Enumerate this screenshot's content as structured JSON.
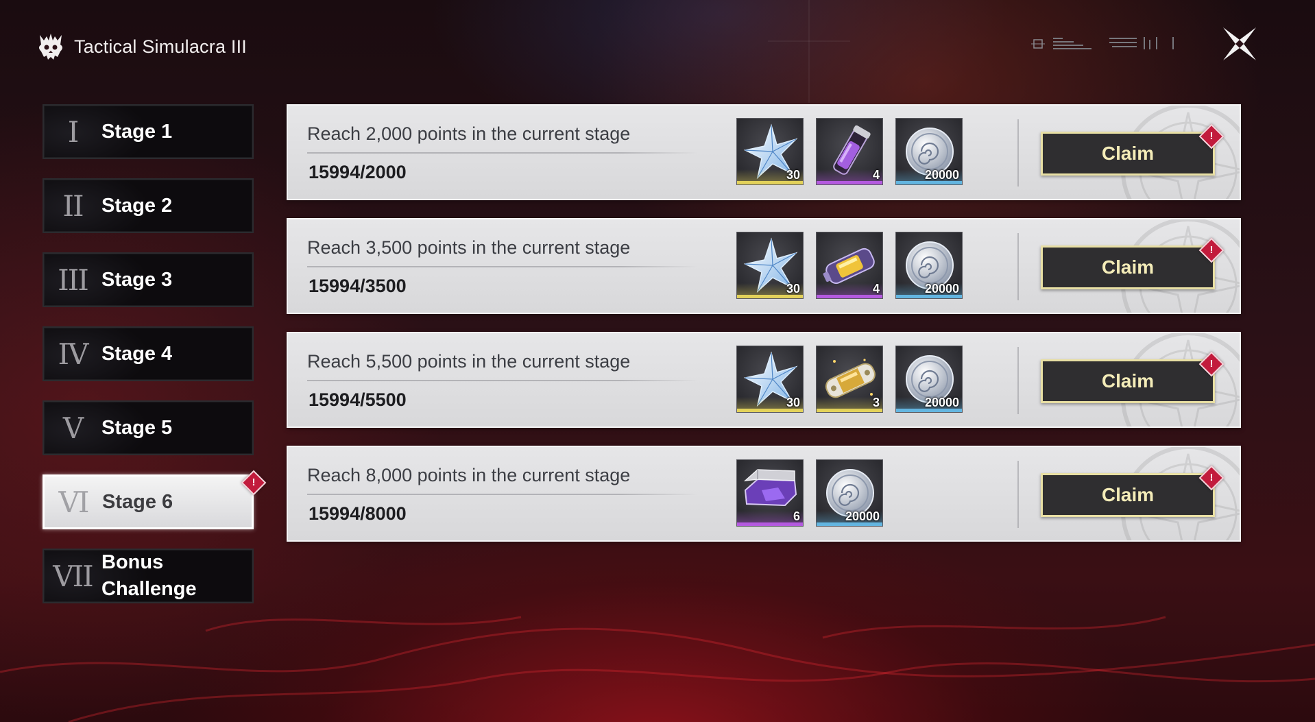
{
  "header": {
    "title": "Tactical Simulacra III",
    "logo_icon": "demon-skull-icon",
    "close_icon": "close-x-icon"
  },
  "colors": {
    "accent_gold": "#e8dfa4",
    "badge_red": "#c21b3c",
    "rarity_gold": "#e2d15a",
    "rarity_purple": "#b45adf",
    "rarity_blue": "#63b5e0"
  },
  "sidebar": {
    "items": [
      {
        "numeral": "I",
        "label": "Stage 1",
        "active": false,
        "badge": false
      },
      {
        "numeral": "II",
        "label": "Stage 2",
        "active": false,
        "badge": false
      },
      {
        "numeral": "III",
        "label": "Stage 3",
        "active": false,
        "badge": false
      },
      {
        "numeral": "IV",
        "label": "Stage 4",
        "active": false,
        "badge": false
      },
      {
        "numeral": "V",
        "label": "Stage 5",
        "active": false,
        "badge": false
      },
      {
        "numeral": "VI",
        "label": "Stage 6",
        "active": true,
        "badge": true
      },
      {
        "numeral": "VII",
        "label": "Bonus Challenge",
        "active": false,
        "badge": false
      }
    ]
  },
  "missions": [
    {
      "description": "Reach 2,000 points in the current stage",
      "progress": "15994/2000",
      "claim_label": "Claim",
      "badge": "!",
      "rewards": [
        {
          "icon": "star-crystal-icon",
          "quantity": "30",
          "rarity": "gold"
        },
        {
          "icon": "purple-vial-icon",
          "quantity": "4",
          "rarity": "purple"
        },
        {
          "icon": "silver-coin-icon",
          "quantity": "20000",
          "rarity": "blue"
        }
      ]
    },
    {
      "description": "Reach 3,500 points in the current stage",
      "progress": "15994/3500",
      "claim_label": "Claim",
      "badge": "!",
      "rewards": [
        {
          "icon": "star-crystal-icon",
          "quantity": "30",
          "rarity": "gold"
        },
        {
          "icon": "energy-battery-icon",
          "quantity": "4",
          "rarity": "purple"
        },
        {
          "icon": "silver-coin-icon",
          "quantity": "20000",
          "rarity": "blue"
        }
      ]
    },
    {
      "description": "Reach 5,500 points in the current stage",
      "progress": "15994/5500",
      "claim_label": "Claim",
      "badge": "!",
      "rewards": [
        {
          "icon": "star-crystal-icon",
          "quantity": "30",
          "rarity": "gold"
        },
        {
          "icon": "gold-capsule-icon",
          "quantity": "3",
          "rarity": "gold"
        },
        {
          "icon": "silver-coin-icon",
          "quantity": "20000",
          "rarity": "blue"
        }
      ]
    },
    {
      "description": "Reach 8,000 points in the current stage",
      "progress": "15994/8000",
      "claim_label": "Claim",
      "badge": "!",
      "rewards": [
        {
          "icon": "purple-chest-icon",
          "quantity": "6",
          "rarity": "purple"
        },
        {
          "icon": "silver-coin-icon",
          "quantity": "20000",
          "rarity": "blue"
        }
      ]
    }
  ]
}
